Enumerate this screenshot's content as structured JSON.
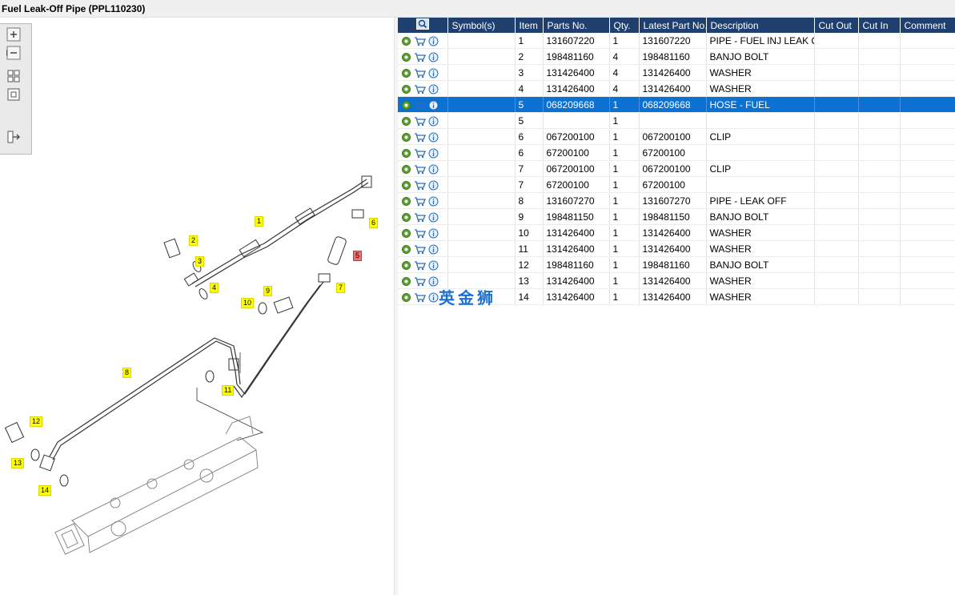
{
  "window": {
    "title": "Fuel Leak-Off Pipe (PPL110230)"
  },
  "toolbox": {
    "buttons": [
      "zoom-in-icon",
      "zoom-out-icon",
      "fit-all-icon",
      "fit-window-icon",
      "export-icon"
    ]
  },
  "diagram": {
    "callouts": [
      "1",
      "2",
      "3",
      "4",
      "5",
      "6",
      "7",
      "8",
      "9",
      "10",
      "11",
      "12",
      "13",
      "14"
    ]
  },
  "table": {
    "columns": [
      "Symbol(s)",
      "Item",
      "Parts No.",
      "Qty.",
      "Latest Part No.",
      "Description",
      "Cut Out",
      "Cut In",
      "Comment"
    ],
    "selected_row": 4,
    "rows": [
      {
        "item": "1",
        "part": "131607220",
        "qty": "1",
        "latest": "131607220",
        "desc": "PIPE - FUEL INJ LEAK OFF"
      },
      {
        "item": "2",
        "part": "198481160",
        "qty": "4",
        "latest": "198481160",
        "desc": "BANJO BOLT"
      },
      {
        "item": "3",
        "part": "131426400",
        "qty": "4",
        "latest": "131426400",
        "desc": "WASHER"
      },
      {
        "item": "4",
        "part": "131426400",
        "qty": "4",
        "latest": "131426400",
        "desc": "WASHER"
      },
      {
        "item": "5",
        "part": "068209668",
        "qty": "1",
        "latest": "068209668",
        "desc": "HOSE - FUEL"
      },
      {
        "item": "5",
        "part": "",
        "qty": "1",
        "latest": "",
        "desc": ""
      },
      {
        "item": "6",
        "part": "067200100",
        "qty": "1",
        "latest": "067200100",
        "desc": "CLIP"
      },
      {
        "item": "6",
        "part": "67200100",
        "qty": "1",
        "latest": "67200100",
        "desc": ""
      },
      {
        "item": "7",
        "part": "067200100",
        "qty": "1",
        "latest": "067200100",
        "desc": "CLIP"
      },
      {
        "item": "7",
        "part": "67200100",
        "qty": "1",
        "latest": "67200100",
        "desc": ""
      },
      {
        "item": "8",
        "part": "131607270",
        "qty": "1",
        "latest": "131607270",
        "desc": "PIPE - LEAK OFF"
      },
      {
        "item": "9",
        "part": "198481150",
        "qty": "1",
        "latest": "198481150",
        "desc": "BANJO BOLT"
      },
      {
        "item": "10",
        "part": "131426400",
        "qty": "1",
        "latest": "131426400",
        "desc": "WASHER"
      },
      {
        "item": "11",
        "part": "131426400",
        "qty": "1",
        "latest": "131426400",
        "desc": "WASHER"
      },
      {
        "item": "12",
        "part": "198481160",
        "qty": "1",
        "latest": "198481160",
        "desc": "BANJO BOLT"
      },
      {
        "item": "13",
        "part": "131426400",
        "qty": "1",
        "latest": "131426400",
        "desc": "WASHER"
      },
      {
        "item": "14",
        "part": "131426400",
        "qty": "1",
        "latest": "131426400",
        "desc": "WASHER"
      }
    ]
  },
  "watermark": "英金狮",
  "colors": {
    "header_bg": "#1f3f6e",
    "selected_bg": "#0b72d3",
    "callout": "#ffff00",
    "callout_highlight": "#f07070"
  }
}
